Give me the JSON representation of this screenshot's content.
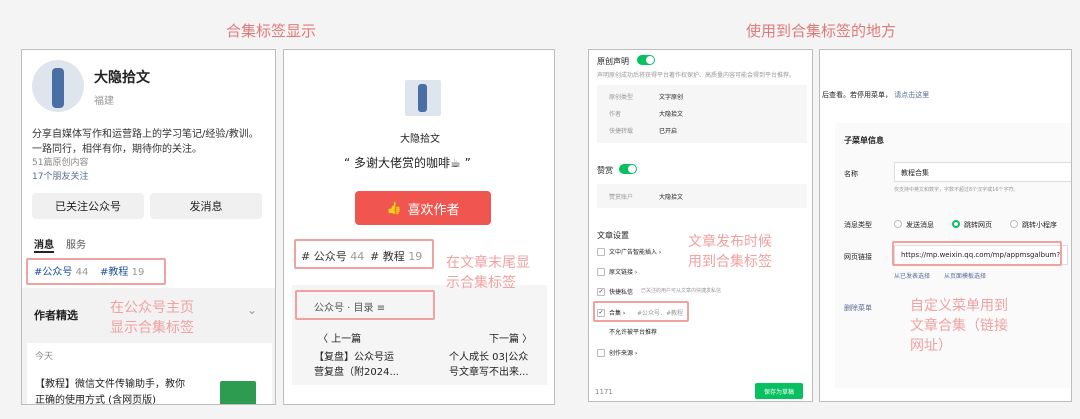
{
  "headings": {
    "left": "合集标签显示",
    "right": "使用到合集标签的地方"
  },
  "profile": {
    "name": "大隐拾文",
    "location": "福建",
    "bio1": "分享自媒体写作和运营路上的学习笔记/经验/教训。",
    "bio2": "一路同行，相伴有你，期待你的关注。",
    "original_count": "51篇原创内容",
    "friends": "17个朋友关注",
    "followed_button": "已关注公众号",
    "message_button": "发消息",
    "tab_messages": "消息",
    "tab_services": "服务",
    "tag1": "#公众号",
    "tag1_count": "44",
    "tag2": "#教程",
    "tag2_count": "19",
    "author_picks": "作者精选",
    "today": "今天",
    "article_title1": "【教程】微信文件传输助手，教你",
    "article_title2": "正确的使用方式 (含网页版)"
  },
  "article_end": {
    "author": "大隐拾文",
    "quote": "“ 多谢大佬赏的咖啡☕ ”",
    "like_button": "喜欢作者",
    "tag1": "# 公众号",
    "tag1_count": "44",
    "tag2": "# 教程",
    "tag2_count": "19",
    "catalog": "公众号 · 目录",
    "prev_label": "〈 上一篇",
    "next_label": "下一篇 〉",
    "prev_title1": "【复盘】公众号运",
    "prev_title2": "营复盘（附2024...",
    "next_title1": "个人成长 03|公众",
    "next_title2": "号文章写不出来..."
  },
  "publish": {
    "original_label": "原创声明",
    "original_desc": "声明原创成功后将获得平台著作权保护、高质量内容可能会得到平台推荐。",
    "type_label": "原创类型",
    "type_value": "文字原创",
    "author_label": "作者",
    "author_value": "大隐拾文",
    "repost_label": "快捷转载",
    "repost_value": "已开启",
    "reward_label": "赞赏",
    "reward_account_label": "赞赏账户",
    "reward_account_value": "大隐拾文",
    "settings_label": "文章设置",
    "opt_ads": "文中广告智能插入 ›",
    "opt_source": "原文链接 ›",
    "opt_quickmsg": "快捷私信",
    "opt_quickmsg_desc": "已关注的用户可从文章内快捷发私信",
    "opt_collection": "合集 ›",
    "opt_collection_tags": "#公众号、#教程",
    "opt_no_recommend": "不允许被平台推荐",
    "opt_creation_source": "创作来源 ›",
    "word_count": "1171",
    "save_button": "保存为草稿"
  },
  "menu": {
    "top_text": "后查看。若停用菜单，",
    "top_link": "请点击这里",
    "section_title": "子菜单信息",
    "name_label": "名称",
    "name_value": "教程合集",
    "name_hint": "仅支持中英文和数字，字数不超过8个汉字或16个字符。",
    "type_label": "消息类型",
    "type_opt1": "发送消息",
    "type_opt2": "跳转网页",
    "type_opt3": "跳转小程序",
    "link_label": "网页链接",
    "link_value": "https://mp.weixin.qq.com/mp/appmsgalbum?",
    "link_opt1": "从已发表选择",
    "link_opt2": "从页面模板选择",
    "delete_label": "删除菜单"
  },
  "notes": {
    "profile_note1": "在公众号主页",
    "profile_note2": "显示合集标签",
    "end_note1": "在文章末尾显",
    "end_note2": "示合集标签",
    "publish_note1": "文章发布时候",
    "publish_note2": "用到合集标签",
    "menu_note1": "自定义菜单用到",
    "menu_note2": "文章合集（链接",
    "menu_note3": "网址）"
  },
  "colors": {
    "accent": "#07c160",
    "annotation": "#f2a1a1",
    "like_button": "#f0564f",
    "link": "#576b95"
  }
}
